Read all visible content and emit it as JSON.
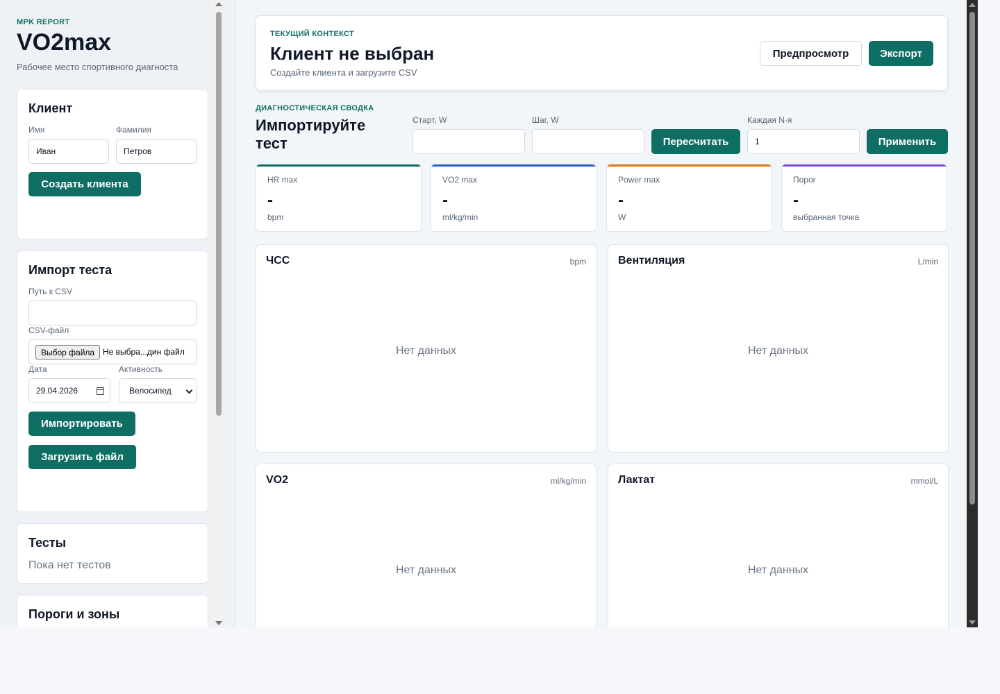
{
  "brand": {
    "eyebrow": "MPK REPORT",
    "title": "VO2max",
    "subtitle": "Рабочее место спортивного диагноста"
  },
  "client_card": {
    "title": "Клиент",
    "first_name_label": "Имя",
    "first_name_value": "Иван",
    "last_name_label": "Фамилия",
    "last_name_value": "Петров",
    "create_button": "Создать клиента"
  },
  "import_card": {
    "title": "Импорт теста",
    "csv_path_label": "Путь к CSV",
    "csv_path_value": "",
    "csv_file_label": "CSV-файл",
    "file_button": "Выбор файла",
    "file_name": "Не выбра...дин файл",
    "date_label": "Дата",
    "date_value": "29.04.2026",
    "activity_label": "Активность",
    "activity_value": "Велосипед",
    "import_button": "Импортировать",
    "upload_button": "Загрузить файл"
  },
  "tests_card": {
    "title": "Тесты",
    "empty": "Пока нет тестов"
  },
  "thresholds_card": {
    "title": "Пороги и зоны"
  },
  "context": {
    "eyebrow": "ТЕКУЩИЙ КОНТЕКСТ",
    "title": "Клиент не выбран",
    "subtitle": "Создайте клиента и загрузите CSV",
    "preview_button": "Предпросмотр",
    "export_button": "Экспорт"
  },
  "summary": {
    "eyebrow": "ДИАГНОСТИЧЕСКАЯ СВОДКА",
    "title": "Импортируйте тест",
    "start_label": "Старт, W",
    "start_value": "",
    "step_label": "Шаг, W",
    "step_value": "",
    "recalc_button": "Пересчитать",
    "nth_label": "Каждая N-я",
    "nth_value": "1",
    "apply_button": "Применить"
  },
  "metrics": [
    {
      "label": "HR max",
      "value": "-",
      "unit": "bpm",
      "color": "#0f6e63"
    },
    {
      "label": "VO2 max",
      "value": "-",
      "unit": "ml/kg/min",
      "color": "#2563c9"
    },
    {
      "label": "Power max",
      "value": "-",
      "unit": "W",
      "color": "#d97a14"
    },
    {
      "label": "Порог",
      "value": "-",
      "unit": "выбранная точка",
      "color": "#7c4ad8"
    }
  ],
  "charts": [
    {
      "title": "ЧСС",
      "unit": "bpm",
      "empty": "Нет данных"
    },
    {
      "title": "Вентиляция",
      "unit": "L/min",
      "empty": "Нет данных"
    },
    {
      "title": "VO2",
      "unit": "ml/kg/min",
      "empty": "Нет данных"
    },
    {
      "title": "Лактат",
      "unit": "mmol/L",
      "empty": "Нет данных"
    }
  ]
}
